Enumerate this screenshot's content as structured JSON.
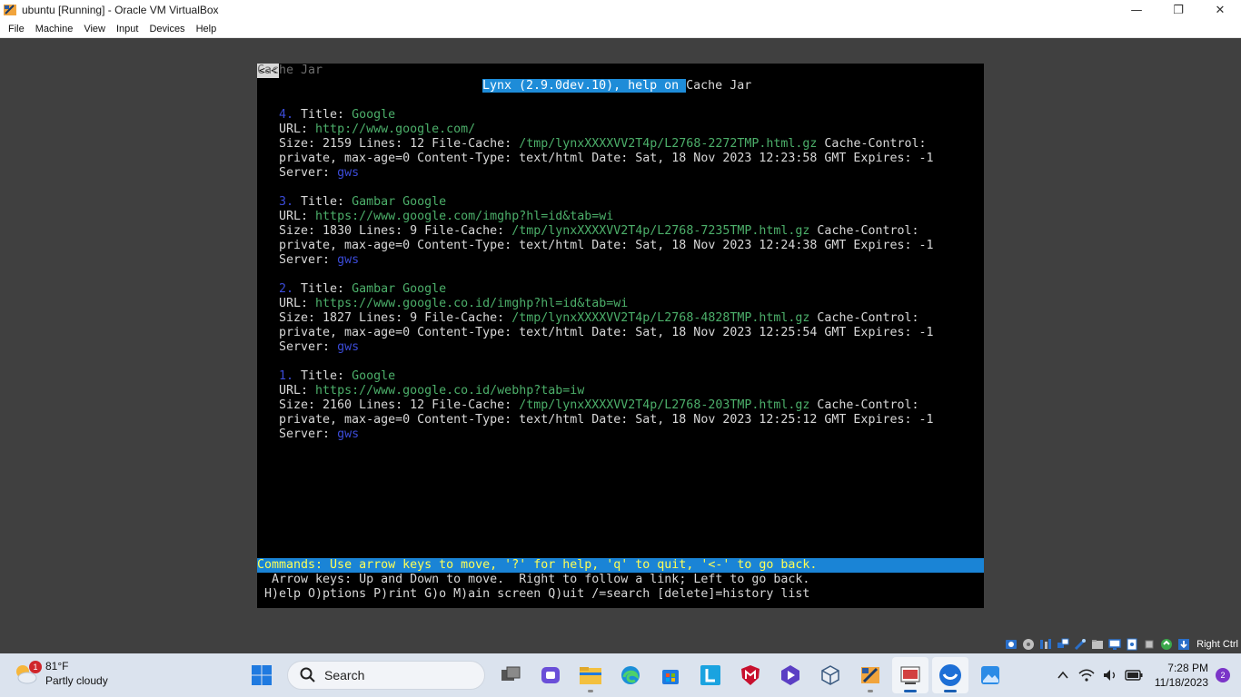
{
  "window": {
    "title": "ubuntu [Running] - Oracle VM VirtualBox",
    "controls": {
      "minimize": "—",
      "restore": "❐",
      "close": "✕"
    }
  },
  "menu": [
    "File",
    "Machine",
    "View",
    "Input",
    "Devices",
    "Help"
  ],
  "terminal": {
    "back_link": "<<<",
    "corner_title": "Cache Jar",
    "header_highlight": "Lynx (2.9.0dev.10), help on ",
    "header_rest": "Cache Jar",
    "entries": [
      {
        "num": "4.",
        "title_label": "Title:",
        "title": "Google",
        "url_label": "URL:",
        "url": "http://www.google.com/",
        "size_prefix": "Size: 2159 Lines: 12 File-Cache: ",
        "file": "/tmp/lynxXXXXVV2T4p/L2768-2272TMP.html.gz",
        "size_suffix": " Cache-Control:",
        "line3": "private, max-age=0 Content-Type: text/html Date: Sat, 18 Nov 2023 12:23:58 GMT Expires: -1",
        "server_label": "Server:",
        "server": "gws"
      },
      {
        "num": "3.",
        "title_label": "Title:",
        "title": "Gambar Google",
        "url_label": "URL:",
        "url": "https://www.google.com/imghp?hl=id&tab=wi",
        "size_prefix": "Size: 1830 Lines: 9 File-Cache: ",
        "file": "/tmp/lynxXXXXVV2T4p/L2768-7235TMP.html.gz",
        "size_suffix": " Cache-Control:",
        "line3": "private, max-age=0 Content-Type: text/html Date: Sat, 18 Nov 2023 12:24:38 GMT Expires: -1",
        "server_label": "Server:",
        "server": "gws"
      },
      {
        "num": "2.",
        "title_label": "Title:",
        "title": "Gambar Google",
        "url_label": "URL:",
        "url": "https://www.google.co.id/imghp?hl=id&tab=wi",
        "size_prefix": "Size: 1827 Lines: 9 File-Cache: ",
        "file": "/tmp/lynxXXXXVV2T4p/L2768-4828TMP.html.gz",
        "size_suffix": " Cache-Control:",
        "line3": "private, max-age=0 Content-Type: text/html Date: Sat, 18 Nov 2023 12:25:54 GMT Expires: -1",
        "server_label": "Server:",
        "server": "gws"
      },
      {
        "num": "1.",
        "title_label": "Title:",
        "title": "Google",
        "url_label": "URL:",
        "url": "https://www.google.co.id/webhp?tab=iw",
        "size_prefix": "Size: 2160 Lines: 12 File-Cache: ",
        "file": "/tmp/lynxXXXXVV2T4p/L2768-203TMP.html.gz",
        "size_suffix": " Cache-Control:",
        "line3": "private, max-age=0 Content-Type: text/html Date: Sat, 18 Nov 2023 12:25:12 GMT Expires: -1",
        "server_label": "Server:",
        "server": "gws"
      }
    ],
    "commands_bar": "Commands: Use arrow keys to move, '?' for help, 'q' to quit, '<-' to go back.",
    "help_line1": "  Arrow keys: Up and Down to move.  Right to follow a link; Left to go back.",
    "help_line2": " H)elp O)ptions P)rint G)o M)ain screen Q)uit /=search [delete]=history list"
  },
  "vbox_status": {
    "host_key": "Right Ctrl"
  },
  "taskbar": {
    "weather": {
      "badge": "1",
      "temp": "81°F",
      "condition": "Partly cloudy"
    },
    "search_label": "Search",
    "clock": {
      "time": "7:28 PM",
      "date": "11/18/2023"
    },
    "notification_count": "2"
  },
  "colors": {
    "term_bg": "#000000",
    "link_green": "#4caf6a",
    "number_blue": "#3050ff",
    "status_bar": "#1a84d6",
    "status_text": "#ffff55"
  }
}
